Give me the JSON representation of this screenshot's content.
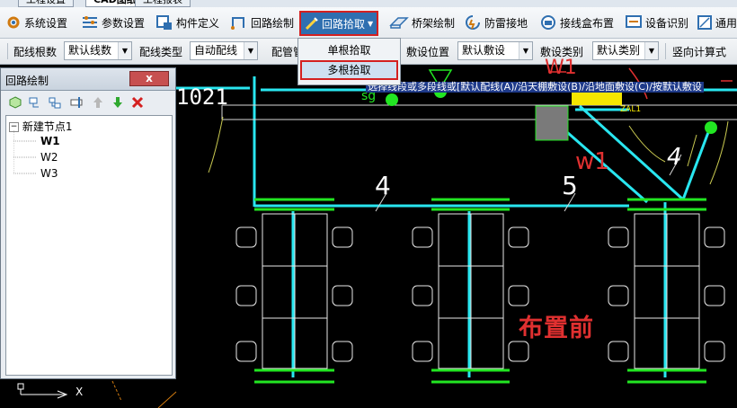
{
  "top_tabs": [
    "工程设置",
    "CAD图纸",
    "工程报表"
  ],
  "toolbar": [
    {
      "label": "系统设置",
      "icon": "gear-icon"
    },
    {
      "label": "参数设置",
      "icon": "params-icon"
    },
    {
      "label": "构件定义",
      "icon": "component-icon"
    },
    {
      "label": "回路绘制",
      "icon": "circuit-draw-icon"
    },
    {
      "label": "回路拾取",
      "icon": "pick-icon"
    },
    {
      "label": "桥架绘制",
      "icon": "tray-icon"
    },
    {
      "label": "防雷接地",
      "icon": "lightning-icon"
    },
    {
      "label": "接线盒布置",
      "icon": "junction-box-icon"
    },
    {
      "label": "设备识别",
      "icon": "device-detect-icon"
    },
    {
      "label": "通用",
      "icon": "general-icon"
    }
  ],
  "options": {
    "wire_count_label": "配线根数",
    "wire_count_value": "默认线数",
    "wire_type_label": "配线类型",
    "wire_type_value": "自动配线",
    "pipe_label": "配管管",
    "lay_pos_label": "敷设位置",
    "lay_pos_value": "默认敷设",
    "lay_cat_label": "敷设类别",
    "lay_cat_value": "默认类别",
    "vertical_calc_label": "竖向计算式"
  },
  "dropdown": {
    "item1": "单根拾取",
    "item2": "多根拾取"
  },
  "panel": {
    "title": "回路绘制",
    "close": "x",
    "tree_root": "新建节点1",
    "tree_items": [
      "W1",
      "W2",
      "W3"
    ]
  },
  "cad": {
    "status_line": "选择线段或多段线或[默认配线(A)/沿天棚敷设(B)/沿地面敷设(C)/按默认敷设",
    "label_4": "4",
    "label_5": "5",
    "label_4_italic": "4",
    "label_w1": "w1",
    "label_w1_top": "W1",
    "label_1021": "1021",
    "label_sg": "sg",
    "label_zalt": "ZAL1",
    "before_label": "布置前",
    "ucs_x": "X"
  },
  "colors": {
    "cyan": "#29e6f0",
    "green": "#22e622",
    "red": "#e03030",
    "accent": "#2f6fb0"
  }
}
